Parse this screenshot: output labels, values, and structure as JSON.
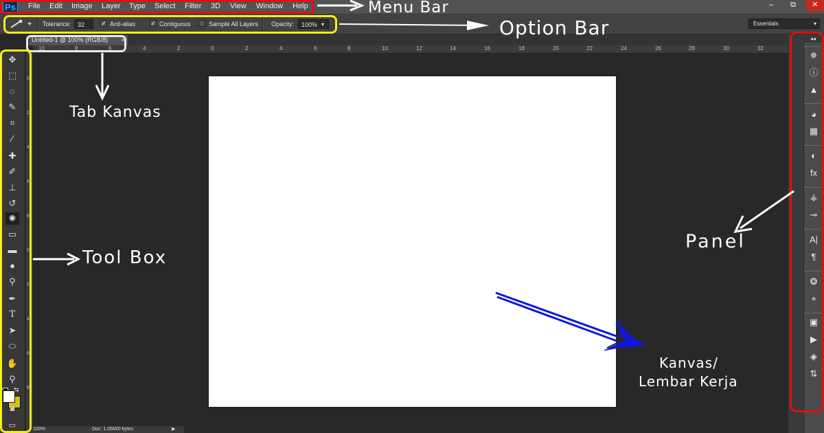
{
  "app": {
    "logo": "Ps"
  },
  "menubar": {
    "items": [
      "File",
      "Edit",
      "Image",
      "Layer",
      "Type",
      "Select",
      "Filter",
      "3D",
      "View",
      "Window",
      "Help"
    ]
  },
  "window_controls": [
    "–",
    "⧉",
    "✕"
  ],
  "options": {
    "tool_preset_icon": "magic-wand-icon",
    "tolerance_label": "Tolerance:",
    "tolerance_value": "32",
    "anti_alias_label": "Anti-alias",
    "anti_alias_checked": true,
    "contiguous_label": "Contiguous",
    "contiguous_checked": true,
    "sample_all_label": "Sample All Layers",
    "sample_all_checked": false,
    "opacity_label": "Opacity:",
    "opacity_value": "100%",
    "workspace": "Essentials"
  },
  "document": {
    "tab_title": "Untitled-1 @ 100% (RGB/8)",
    "tab_close": "×",
    "zoom": "100%",
    "doc_info": "Doc: 1.05M/0 bytes"
  },
  "ruler_top": [
    "10",
    "8",
    "6",
    "4",
    "2",
    "0",
    "2",
    "4",
    "6",
    "8",
    "10",
    "12",
    "14",
    "16",
    "18",
    "20",
    "22",
    "24",
    "26",
    "28",
    "30",
    "32"
  ],
  "ruler_left": [
    "0",
    "2",
    "4",
    "6",
    "8",
    "0",
    "2",
    "4",
    "6",
    "8"
  ],
  "annotations": {
    "menu_bar": "Menu Bar",
    "option_bar": "Option Bar",
    "tab_kanvas": "Tab Kanvas",
    "tool_box": "Tool Box",
    "panel": "Panel",
    "kanvas_line1": "Kanvas/",
    "kanvas_line2": "Lembar Kerja"
  },
  "colors": {
    "highlight_red": "#e01010",
    "highlight_yellow": "#f4ee1a",
    "highlight_white": "#e8e8e8",
    "arrow_blue": "#1018e0",
    "foreground_swatch": "#ffffff",
    "background_swatch": "#d7c01a"
  }
}
